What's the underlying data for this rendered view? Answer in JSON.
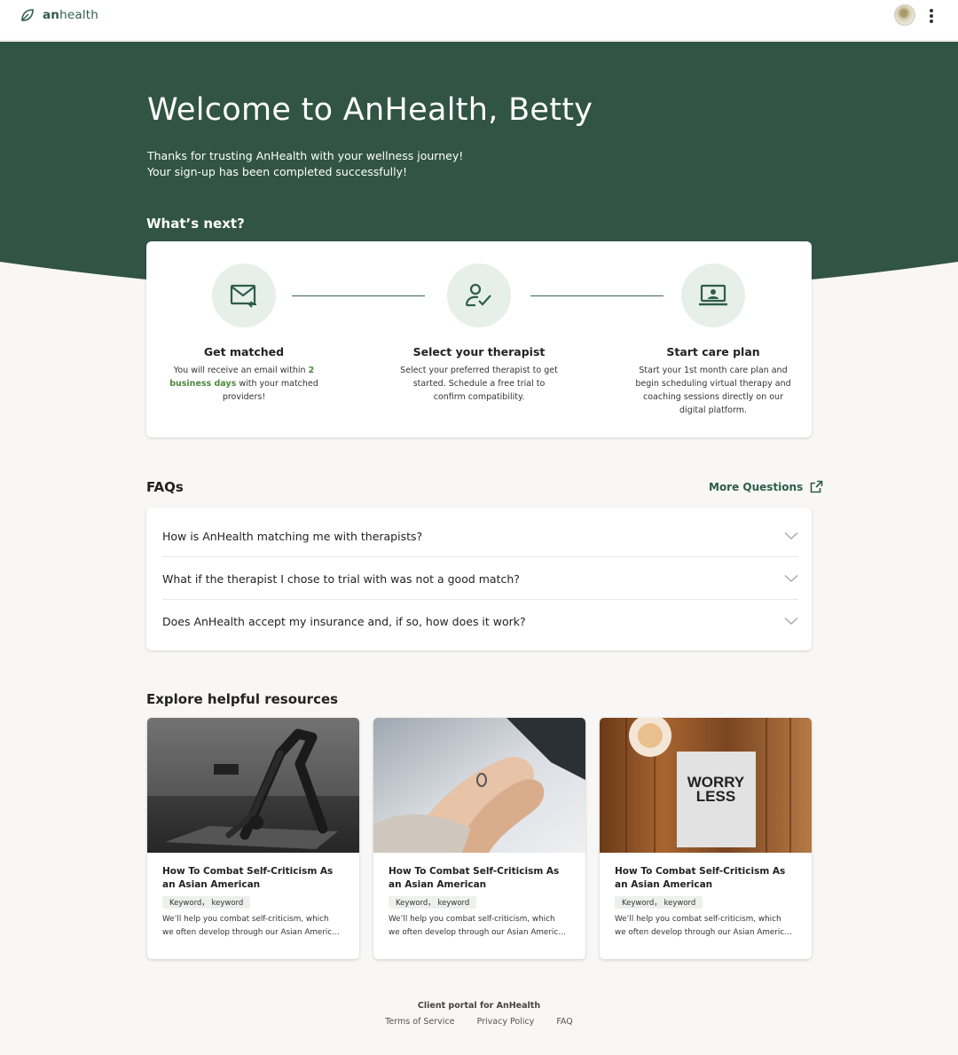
{
  "brand": {
    "name_bold": "an",
    "name_rest": "health"
  },
  "hero": {
    "title": "Welcome to AnHealth, Betty",
    "subtitle_line1": "Thanks for trusting AnHealth with your wellness journey!",
    "subtitle_line2": "Your sign-up has been completed successfully!",
    "whats_next": "What’s next?"
  },
  "steps": [
    {
      "icon": "mail-icon",
      "title": "Get matched",
      "desc_pre": "You will receive an email within",
      "desc_highlight": "2 business days",
      "desc_post": "with your matched providers!"
    },
    {
      "icon": "user-check-icon",
      "title": "Select your therapist",
      "desc": "Select your preferred therapist to get started. Schedule a free trial to confirm compatibility."
    },
    {
      "icon": "laptop-user-icon",
      "title": "Start care plan",
      "desc": "Start your 1st month care plan and begin scheduling virtual therapy and coaching sessions directly on our digital platform."
    }
  ],
  "faq": {
    "heading": "FAQs",
    "more_link": "More Questions",
    "items": [
      "How is AnHealth matching me with therapists?",
      "What if the therapist I chose to trial with was not a good match?",
      "Does AnHealth accept my insurance and, if so, how does it work?"
    ]
  },
  "resources": {
    "heading": "Explore helpful resources",
    "cards": [
      {
        "title": "How To Combat Self-Criticism As an Asian American",
        "tag": "Keyword， keyword",
        "desc_line1": "We’ll help you combat self-criticism, which",
        "desc_line2": "we often develop through our Asian American communities"
      },
      {
        "title": "How To Combat Self-Criticism As an Asian American",
        "tag": "Keyword， keyword",
        "desc_line1": "We’ll help you combat self-criticism, which",
        "desc_line2": "we often develop through our Asian American communities"
      },
      {
        "title": "How To Combat Self-Criticism As an Asian American",
        "tag": "Keyword， keyword",
        "desc_line1": "We’ll help you combat self-criticism, which",
        "desc_line2": "we often develop through our Asian American communities",
        "image_text_line1": "WORRY",
        "image_text_line2": "LESS"
      }
    ]
  },
  "footer": {
    "title": "Client portal for AnHealth",
    "links": [
      "Terms of Service",
      "Privacy Policy",
      "FAQ"
    ]
  },
  "colors": {
    "brand_green": "#315444",
    "accent_green": "#4d8a3e",
    "icon_circle_bg": "#e7efe9",
    "page_bg": "#f8f7f5"
  }
}
